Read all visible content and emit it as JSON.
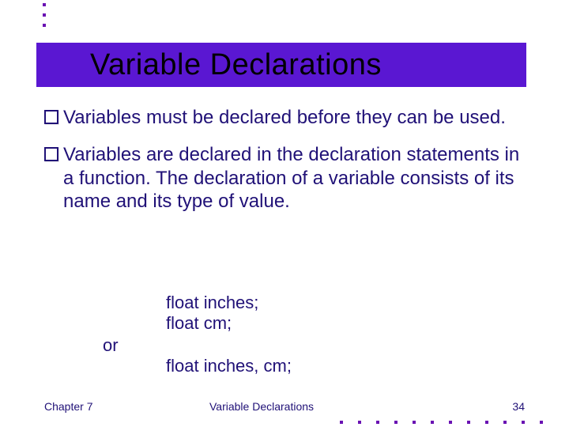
{
  "title": "Variable Declarations",
  "bullets": [
    "Variables must be declared before they can be used.",
    "Variables are declared in the declaration statements in a function.  The declaration of a variable consists of its name and its type of value."
  ],
  "code": {
    "line1": "float inches;",
    "line2": "float cm;",
    "or_label": "or",
    "line3": "float inches, cm;"
  },
  "footer": {
    "left": "Chapter 7",
    "center": "Variable Declarations",
    "right": "34"
  }
}
